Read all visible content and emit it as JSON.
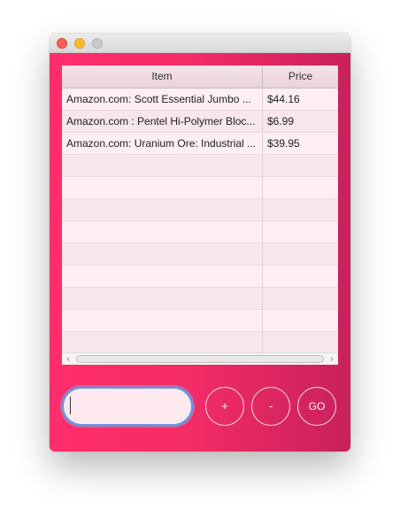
{
  "window": {
    "controls": [
      "close",
      "minimize",
      "maximize"
    ]
  },
  "table": {
    "columns": {
      "item": "Item",
      "price": "Price"
    },
    "rows": [
      {
        "item": "Amazon.com: Scott Essential Jumbo ...",
        "price": "$44.16"
      },
      {
        "item": "Amazon.com : Pentel Hi-Polymer Bloc...",
        "price": "$6.99"
      },
      {
        "item": "Amazon.com: Uranium Ore: Industrial ...",
        "price": "$39.95"
      },
      {
        "item": "",
        "price": ""
      },
      {
        "item": "",
        "price": ""
      },
      {
        "item": "",
        "price": ""
      },
      {
        "item": "",
        "price": ""
      },
      {
        "item": "",
        "price": ""
      },
      {
        "item": "",
        "price": ""
      },
      {
        "item": "",
        "price": ""
      },
      {
        "item": "",
        "price": ""
      },
      {
        "item": "",
        "price": ""
      }
    ],
    "scrollbar": {
      "left_arrow": "‹",
      "right_arrow": "›"
    }
  },
  "controls": {
    "input_value": "",
    "plus_label": "+",
    "minus_label": "-",
    "go_label": "GO"
  },
  "colors": {
    "background_start": "#ff2d6c",
    "background_end": "#c8215c",
    "input_focus": "#5f9ae0"
  }
}
